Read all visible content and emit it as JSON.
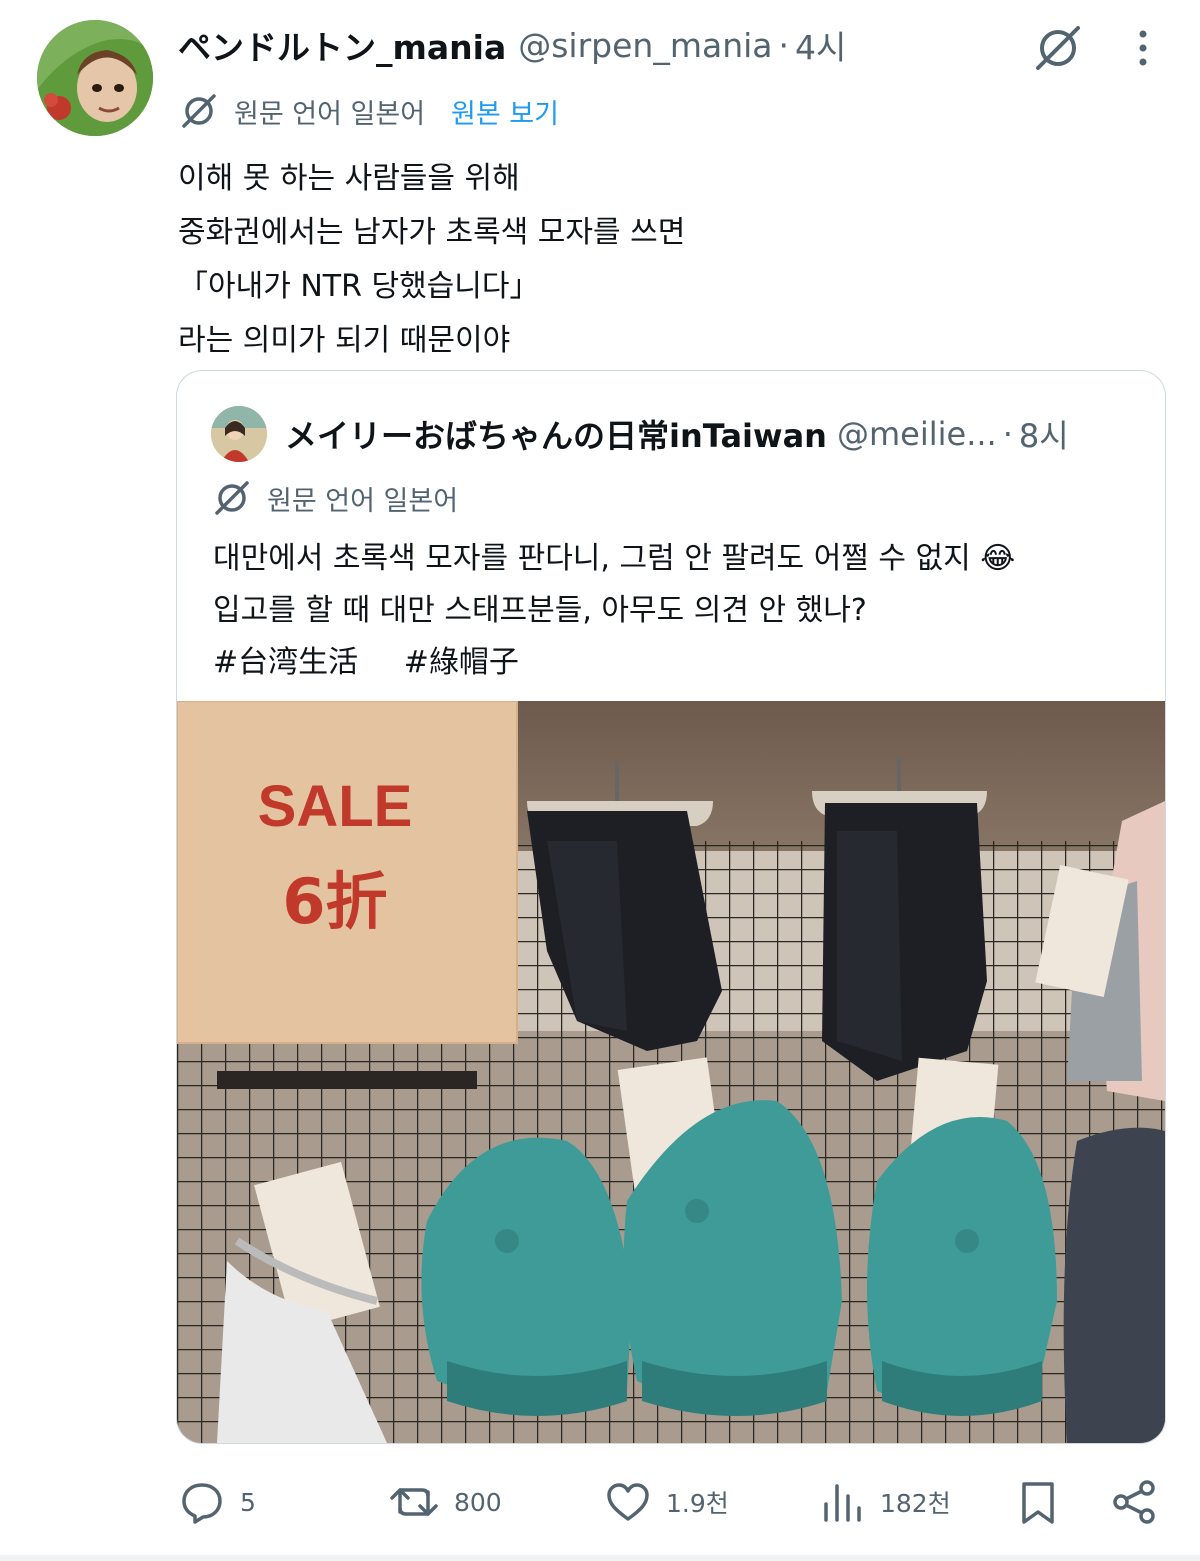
{
  "tweet": {
    "author_name": "ペンドルトン_mania",
    "author_handle": "@sirpen_mania",
    "separator": "·",
    "time": "4시",
    "translation": {
      "label": "원문 언어 일본어",
      "show_original": "원본 보기"
    },
    "lines": [
      "이해 못 하는 사람들을 위해",
      "중화권에서는 남자가 초록색 모자를 쓰면",
      "「아내가 NTR 당했습니다」",
      "라는 의미가 되기 때문이야"
    ]
  },
  "quote": {
    "author_name": "メイリーおばちゃんの日常inTaiwan",
    "author_handle": "@meilie...",
    "separator": "·",
    "time": "8시",
    "translation_label": "원문 언어 일본어",
    "lines": [
      "대만에서 초록색 모자를 판다니, 그럼 안 팔려도 어쩔 수 없지 😂",
      "입고를 할 때 대만 스태프분들, 아무도 의견 안 했나?"
    ],
    "hashtags": [
      "#台湾生活",
      "#綠帽子"
    ],
    "photo": {
      "sign_sale": "SALE",
      "sign_discount": "6折"
    }
  },
  "actions": {
    "replies": "5",
    "reposts": "800",
    "likes": "1.9천",
    "views": "182천"
  },
  "colors": {
    "text": "#0f1419",
    "secondary": "#536471",
    "link": "#1d9bf0",
    "border": "#cfd9de",
    "cap_teal": "#3f9b98"
  }
}
